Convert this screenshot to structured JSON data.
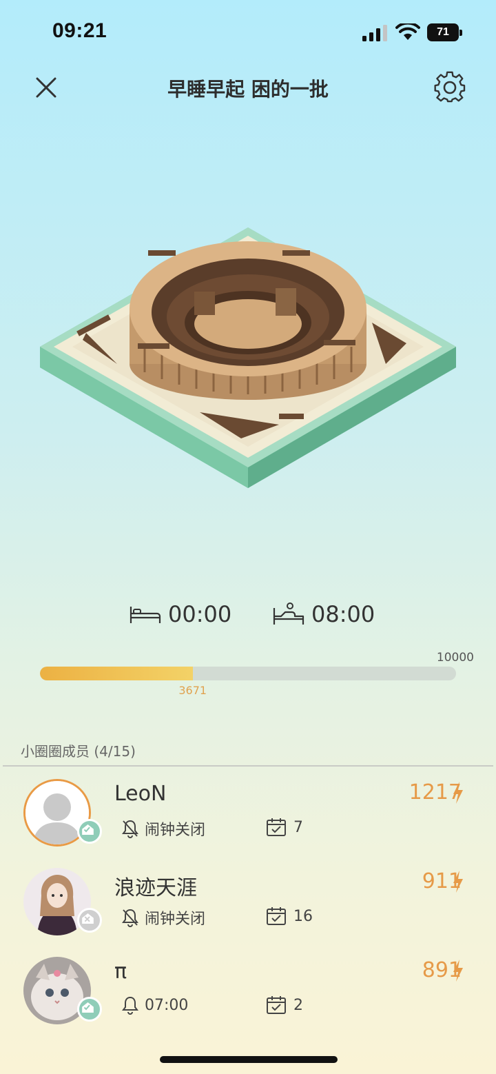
{
  "status_bar": {
    "time": "09:21",
    "battery": "71"
  },
  "header": {
    "title": "早睡早起 困的一批"
  },
  "schedule": {
    "bed_time": "00:00",
    "wake_time": "08:00"
  },
  "progress": {
    "goal": "10000",
    "current": "3671",
    "fraction": 0.3671
  },
  "members_section": {
    "title": "小圈圈成员 (4/15)"
  },
  "members": [
    {
      "name": "LeoN",
      "score": "1217",
      "alarm": "闹钟关闭",
      "checkins": "7",
      "badge": "home-check-icon",
      "avatar": "default-person"
    },
    {
      "name": "浪迹天涯",
      "score": "911",
      "alarm": "闹钟关闭",
      "checkins": "16",
      "badge": "home-x-icon",
      "avatar": "doll"
    },
    {
      "name": "π",
      "score": "891",
      "alarm": "07:00",
      "checkins": "2",
      "badge": "home-check-icon",
      "avatar": "kitten"
    }
  ],
  "colors": {
    "accent": "#e69a48",
    "progress_start": "#ecb143",
    "progress_end": "#f3d267",
    "badge_green": "#8fcdb8"
  }
}
